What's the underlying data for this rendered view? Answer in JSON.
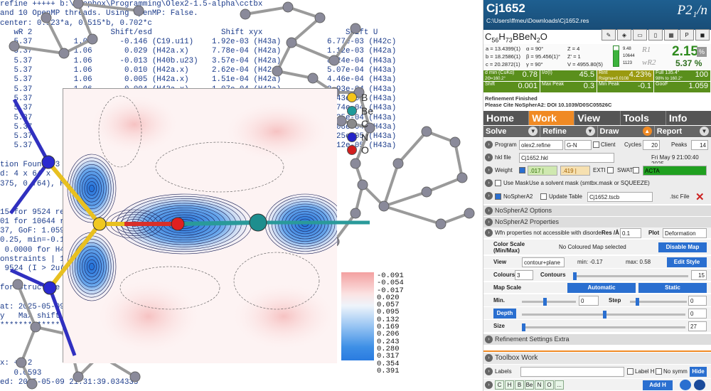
{
  "console": {
    "lines": [
      "refine +++++ b:\\Dropbox\\Programming\\Olex2-1.5-alpha\\cctbx",
      "and 10 OpenMP threads. Using OpenMP: False.",
      "center: 0.523*a, 0.515*b, 0.702*c",
      "   wR 2                 Shift/esd               Shift xyx                  Shift U",
      "   5.37         1.06      -0.146 (C19.u11)    1.92e-03 (H43a)          6.77e-03 (H42c)",
      "   5.37         1.06       0.029 (H42a.x)     7.78e-04 (H42a)          1.12e-03 (H42a)",
      "   5.37         1.06      -0.013 (H40b.u23)   3.57e-04 (H42a)          8.24e-04 (H43a)",
      "   5.37         1.06       0.010 (H42a.x)     2.62e-04 (H42a)          5.07e-04 (H43a)",
      "   5.37         1.06       0.005 (H42a.x)     1.51e-04 (H42a)          4.46e-04 (H43a)",
      "   5.37         1.06       0.004 (H42a.x)     1.07e-04 (H42a)          2.93e-04 (H43a)",
      "   5.37         1.06       0.003 (H42a.x)     7.39e-05 (H42a)          2.43e-04 (H43a)",
      "   5.37         1.06       0.002 (H42a.x)     5.26e-05 (H42a)          1.74e-04 (H43a)",
      "   5.37         1.06       0.002 (H42a.x)     3.99e-05 (H42a)          1.35e-04 (H43a)",
      "   5.37         1.06       0.001 (H42a.x)     2.89e-05 (H42a)          1.08e-04 (H43a)",
      "   5.37         1.06       0.001 (H42a.x)     2.10e-05 (H42a)          8.25e-05 (H43a)",
      "   5.37         1.06       0.001 (H42a.x)     1.69e-05 (H42a)          6.12e-05 (H43a)",
      "",
      "tion Found: 3",
      "d: 4 x 64 x",
      "375, 0.764), H4",
      "",
      "",
      "15 for 9524 refl",
      "01 for 10644 refl",
      "37, GoF: 1.059",
      "0.25, min=-0.12",
      " 0.0000 for H42a",
      "onstraints | 19",
      " 9524 (I > 2u(I",
      "",
      "for Structure C",
      "",
      "at: 2025-05-09",
      "y   Max shift",
      "**********************************************************************",
      "",
      "",
      "",
      "x: +0.2",
      "   0.0593",
      "ed: 2025-05-09 21:31:39.034335"
    ]
  },
  "viewer": {
    "element_key": [
      {
        "symbol": "B",
        "color": "#f5c518"
      },
      {
        "symbol": "Be",
        "color": "#1e9a9a"
      },
      {
        "symbol": "C",
        "color": "#8a8a8a"
      },
      {
        "symbol": "N",
        "color": "#2323c8"
      },
      {
        "symbol": "O",
        "color": "#d21e1e"
      }
    ],
    "contour_legend": [
      "-0.091",
      "-0.054",
      "-0.017",
      "0.020",
      "0.057",
      "0.095",
      "0.132",
      "0.169",
      "0.206",
      "0.243",
      "0.280",
      "0.317",
      "0.354",
      "0.391"
    ]
  },
  "panel": {
    "header": {
      "name": "Cj1652",
      "path": "C:\\Users\\ffmeu\\Downloads\\Cj1652.res",
      "space_group": "P2₁/n"
    },
    "formula": "C56H73BBeN2O",
    "cell": {
      "a": "a = 13.4399(1)",
      "b": "b = 18.2586(1)",
      "c": "c = 20.2872(1)",
      "alpha": "α = 90°",
      "beta": "β = 95.456(1)°",
      "gamma": "γ = 90°",
      "Z": "Z = 4",
      "Zp": "Z' = 1",
      "V": "V = 4955.80(5)",
      "side": [
        "9.48",
        "10644",
        "1123"
      ]
    },
    "r1_label": "R1",
    "r1": "2.15",
    "wr2_label": "wR2",
    "wr2": "5.37 %",
    "stats": [
      {
        "label": "d min (CuKα)",
        "sub": "2Θ=160.2°",
        "value": "0.78",
        "bg": "#5a8f1c"
      },
      {
        "label": "I/σ(I)",
        "sub": "",
        "value": "45.5",
        "bg": "#5a8f1c"
      },
      {
        "label": "Rint",
        "sub": "Rsigma=0.0108",
        "value": "4.23%",
        "bg": "#9a9a10"
      },
      {
        "label": "Full 135.4°",
        "sub": "98% to 160.2°",
        "value": "100",
        "bg": "#5a8f1c"
      },
      {
        "label": "Shift",
        "sub": "",
        "value": "0.001",
        "bg": "#5a8f1c"
      },
      {
        "label": "Max Peak",
        "sub": "",
        "value": "0.3",
        "bg": "#5a8f1c"
      },
      {
        "label": "Min Peak",
        "sub": "",
        "value": "-0.1",
        "bg": "#5a8f1c"
      },
      {
        "label": "GooF",
        "sub": "",
        "value": "1.059",
        "bg": "#5a8f1c"
      }
    ],
    "refine_msg_1": "Refinement Finished",
    "refine_msg_2": "Please Cite NoSpherA2: DOI 10.1039/D0SC05526C",
    "tabs": [
      "Home",
      "Work",
      "View",
      "Tools",
      "Info"
    ],
    "subtabs": [
      "Solve",
      "Refine",
      "Draw",
      "Report"
    ],
    "program": {
      "label": "Program",
      "value": "olex2.refine",
      "method": "G-N",
      "client": "Client",
      "cycles_label": "Cycles",
      "cycles": "20",
      "peaks_label": "Peaks",
      "peaks": "14"
    },
    "hkl": {
      "label": "hkl file",
      "value": "Cj1652.hkl",
      "date": "Fri May 9 21:00:40 2025"
    },
    "weight": {
      "label": "Weight",
      "v1": ".017 | .017",
      "v2": ".419 | .414",
      "exti": "EXTI",
      "swat": "SWAT",
      "acta": "ACTA"
    },
    "mask": {
      "label": "Use Mask",
      "text": "Use a solvent mask (smtbx.mask or SQUEEZE)"
    },
    "nospher": {
      "label": "NoSpherA2",
      "update": "Update Table",
      "file": "Cj1652.tscb",
      "tsc": ".tsc File"
    },
    "sect_options": "NoSpherA2 Options",
    "sect_props": "NoSpherA2 Properties",
    "props": {
      "wfn_text": "Wfn properties not accessible with disorder",
      "res_label": "Res /Å",
      "res": "0.1",
      "plot_label": "Plot",
      "plot": "Deformation",
      "colour_scale": "Color Scale (Min/Max)",
      "no_map": "No Coloured Map selected",
      "disable_map": "Disable Map",
      "view_label": "View",
      "view": "contour+plane",
      "min": "min: -0.17",
      "max": "max: 0.58",
      "edit_style": "Edit Style",
      "colours_label": "Colours",
      "colours": "3",
      "contours_label": "Contours",
      "contours": "15",
      "map_scale": "Map Scale",
      "automatic": "Automatic",
      "static": "Static",
      "min_label": "Min.",
      "min_val": "0",
      "step_label": "Step",
      "step_val": "0",
      "depth": "Depth",
      "depth_val": "0",
      "size_label": "Size",
      "size_val": "27"
    },
    "sect_extra": "Refinement Settings Extra",
    "toolbox": {
      "title": "Toolbox Work",
      "labels": "Labels",
      "label_h": "Label H",
      "no_symm": "No symm",
      "hide": "Hide",
      "elements": [
        "C",
        "H",
        "B",
        "Be",
        "N",
        "O",
        "..."
      ],
      "add_h": "Add H"
    }
  }
}
